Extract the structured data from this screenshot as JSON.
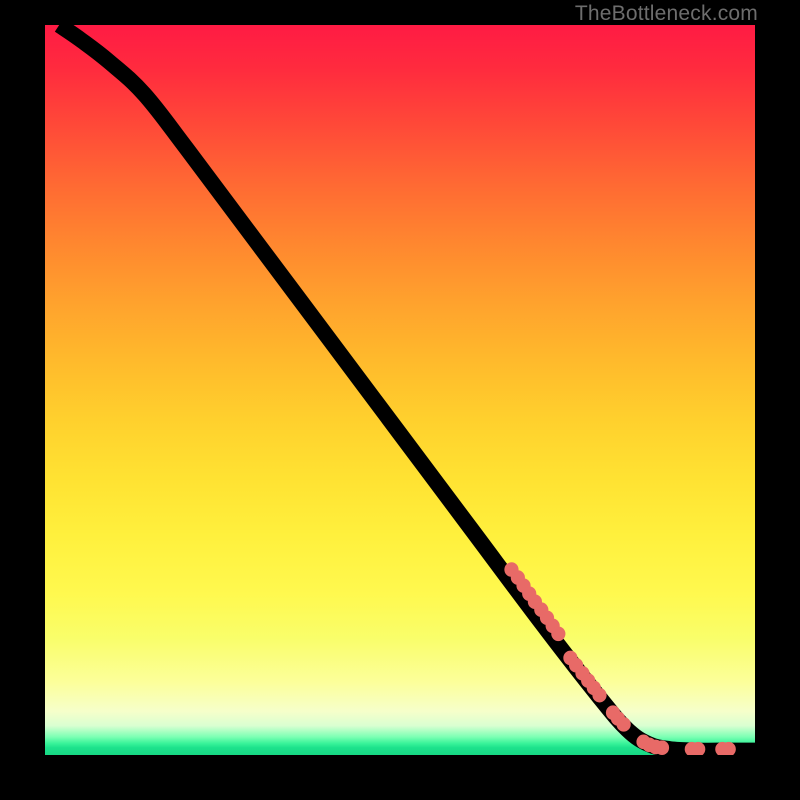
{
  "watermark": "TheBottleneck.com",
  "chart_data": {
    "type": "line",
    "title": "",
    "xlabel": "",
    "ylabel": "",
    "xlim": [
      0,
      100
    ],
    "ylim": [
      0,
      100
    ],
    "grid": false,
    "curve": [
      {
        "x": 2,
        "y": 100
      },
      {
        "x": 5,
        "y": 98
      },
      {
        "x": 9,
        "y": 95
      },
      {
        "x": 14,
        "y": 90.5
      },
      {
        "x": 20,
        "y": 83
      },
      {
        "x": 30,
        "y": 70
      },
      {
        "x": 40,
        "y": 57
      },
      {
        "x": 50,
        "y": 44
      },
      {
        "x": 60,
        "y": 31
      },
      {
        "x": 70,
        "y": 18
      },
      {
        "x": 78,
        "y": 8
      },
      {
        "x": 82,
        "y": 3.5
      },
      {
        "x": 85,
        "y": 1.5
      },
      {
        "x": 88,
        "y": 0.8
      },
      {
        "x": 92,
        "y": 0.6
      },
      {
        "x": 96,
        "y": 0.6
      },
      {
        "x": 100,
        "y": 0.6
      }
    ],
    "marker_groups": [
      [
        {
          "x": 65.7,
          "y": 25.4
        },
        {
          "x": 66.6,
          "y": 24.3
        },
        {
          "x": 67.4,
          "y": 23.2
        },
        {
          "x": 68.2,
          "y": 22.1
        },
        {
          "x": 69.0,
          "y": 21.0
        },
        {
          "x": 69.9,
          "y": 19.9
        },
        {
          "x": 70.7,
          "y": 18.8
        },
        {
          "x": 71.5,
          "y": 17.7
        },
        {
          "x": 72.3,
          "y": 16.6
        }
      ],
      [
        {
          "x": 74.0,
          "y": 13.3
        },
        {
          "x": 74.8,
          "y": 12.3
        },
        {
          "x": 75.7,
          "y": 11.2
        },
        {
          "x": 76.5,
          "y": 10.2
        },
        {
          "x": 77.3,
          "y": 9.2
        },
        {
          "x": 78.1,
          "y": 8.2
        }
      ],
      [
        {
          "x": 80.0,
          "y": 5.8
        },
        {
          "x": 80.7,
          "y": 5.0
        },
        {
          "x": 81.5,
          "y": 4.2
        }
      ],
      [
        {
          "x": 84.3,
          "y": 1.8
        },
        {
          "x": 85.1,
          "y": 1.4
        },
        {
          "x": 86.0,
          "y": 1.1
        },
        {
          "x": 86.9,
          "y": 1.0
        }
      ],
      [
        {
          "x": 91.1,
          "y": 0.8
        },
        {
          "x": 92.0,
          "y": 0.8
        }
      ],
      [
        {
          "x": 95.4,
          "y": 0.8
        },
        {
          "x": 96.3,
          "y": 0.8
        }
      ]
    ],
    "marker_radius": 1.0
  }
}
